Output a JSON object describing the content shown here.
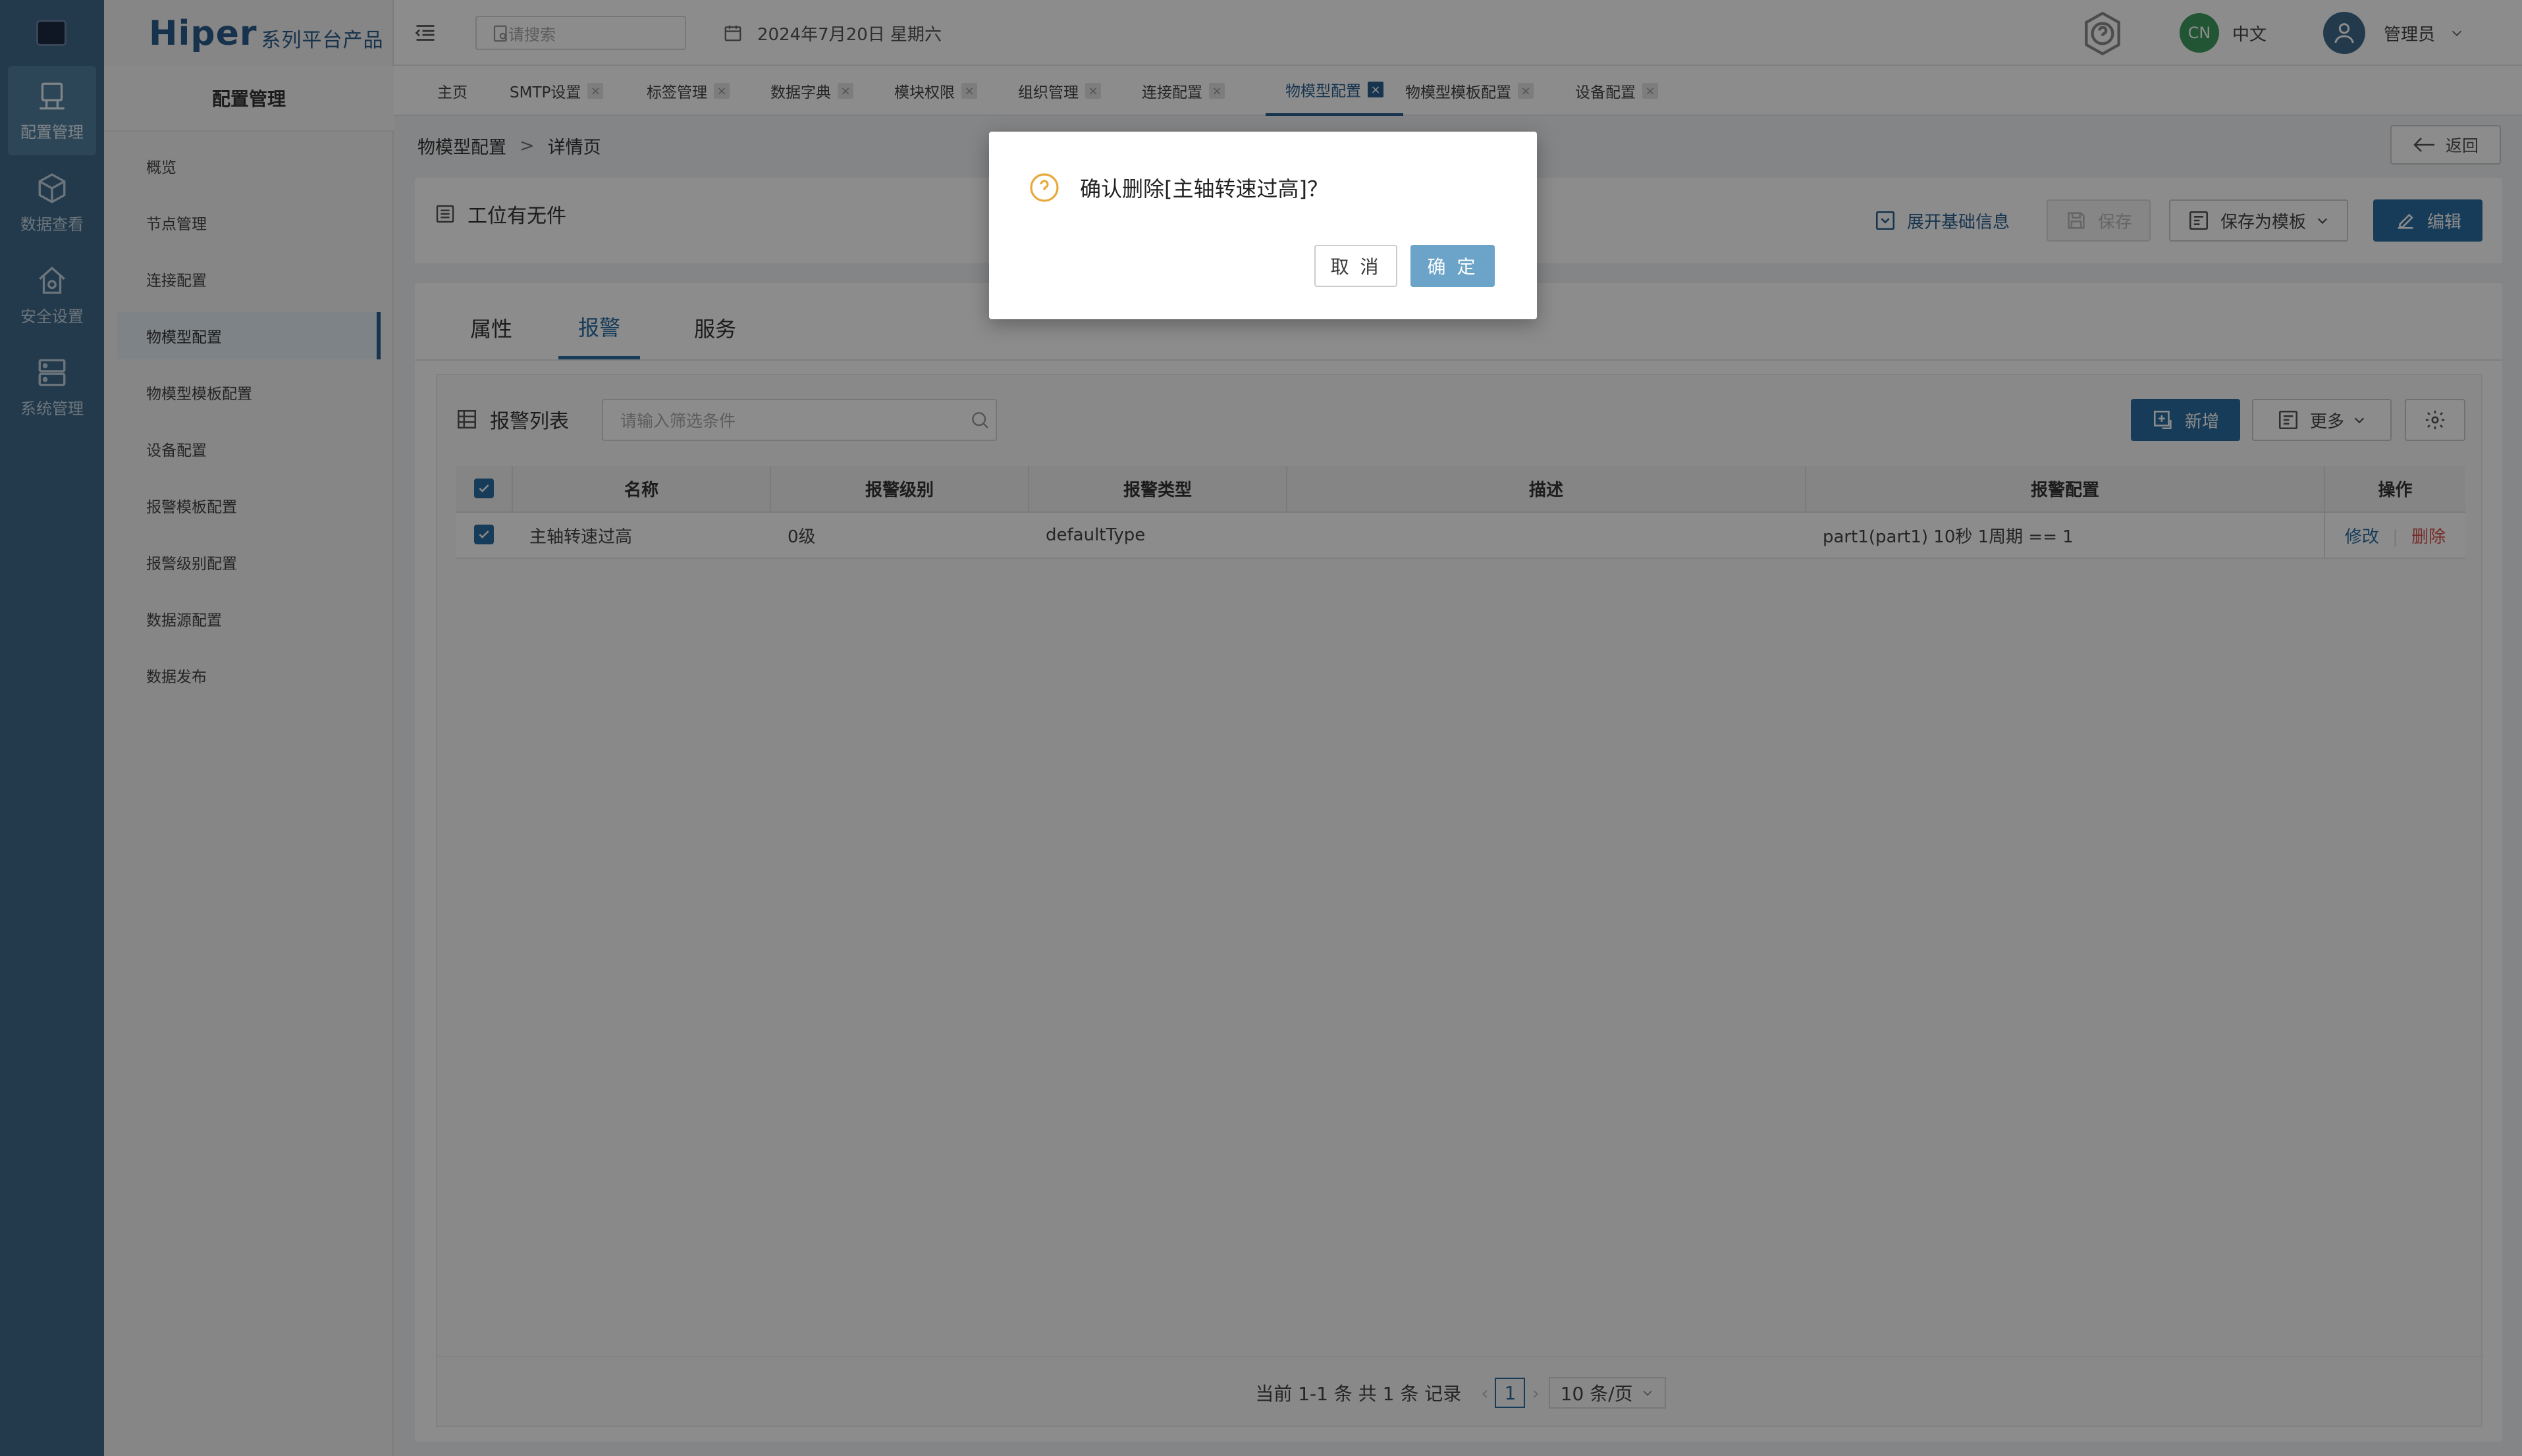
{
  "rail": {
    "items": [
      {
        "label": "配置管理",
        "active": true
      },
      {
        "label": "数据查看"
      },
      {
        "label": "安全设置"
      },
      {
        "label": "系统管理"
      }
    ]
  },
  "menu": {
    "brand": "Hiper",
    "brand_sub": "系列平台产品",
    "title": "配置管理",
    "items": [
      "概览",
      "节点管理",
      "连接配置",
      "物模型配置",
      "物模型模板配置",
      "设备配置",
      "报警模板配置",
      "报警级别配置",
      "数据源配置",
      "数据发布"
    ],
    "active_index": 3
  },
  "topbar": {
    "search_placeholder": "请搜索",
    "date": "2024年7月20日 星期六",
    "lang_badge": "CN",
    "lang": "中文",
    "user": "管理员"
  },
  "tabs": [
    "主页",
    "SMTP设置",
    "标签管理",
    "数据字典",
    "模块权限",
    "组织管理",
    "连接配置",
    "物模型配置",
    "物模型模板配置",
    "设备配置"
  ],
  "breadcrumb": {
    "parent": "物模型配置",
    "sep": ">",
    "current": "详情页"
  },
  "back_label": "返回",
  "detail": {
    "title": "工位有无件",
    "expand_label": "展开基础信息",
    "save_label": "保存",
    "save_template_label": "保存为模板",
    "edit_label": "编辑"
  },
  "inner_tabs": [
    "属性",
    "报警",
    "服务"
  ],
  "alarm_list": {
    "title": "报警列表",
    "filter_placeholder": "请输入筛选条件",
    "add_label": "新增",
    "more_label": "更多",
    "columns": [
      "名称",
      "报警级别",
      "报警类型",
      "描述",
      "报警配置",
      "操作"
    ],
    "rows": [
      {
        "name": "主轴转速过高",
        "level": "0级",
        "type": "defaultType",
        "desc": "",
        "config": "part1(part1) 10秒 1周期 == 1",
        "edit": "修改",
        "delete": "删除"
      }
    ]
  },
  "pager": {
    "summary": "当前 1-1 条 共 1 条 记录",
    "page": "1",
    "page_size": "10 条/页"
  },
  "modal": {
    "message": "确认删除[主轴转速过高]？",
    "cancel": "取 消",
    "ok": "确 定"
  },
  "colors": {
    "primary": "#2b6ea3",
    "rail": "#3e6a8a",
    "danger": "#d9534f",
    "warn": "#e8a93a"
  }
}
